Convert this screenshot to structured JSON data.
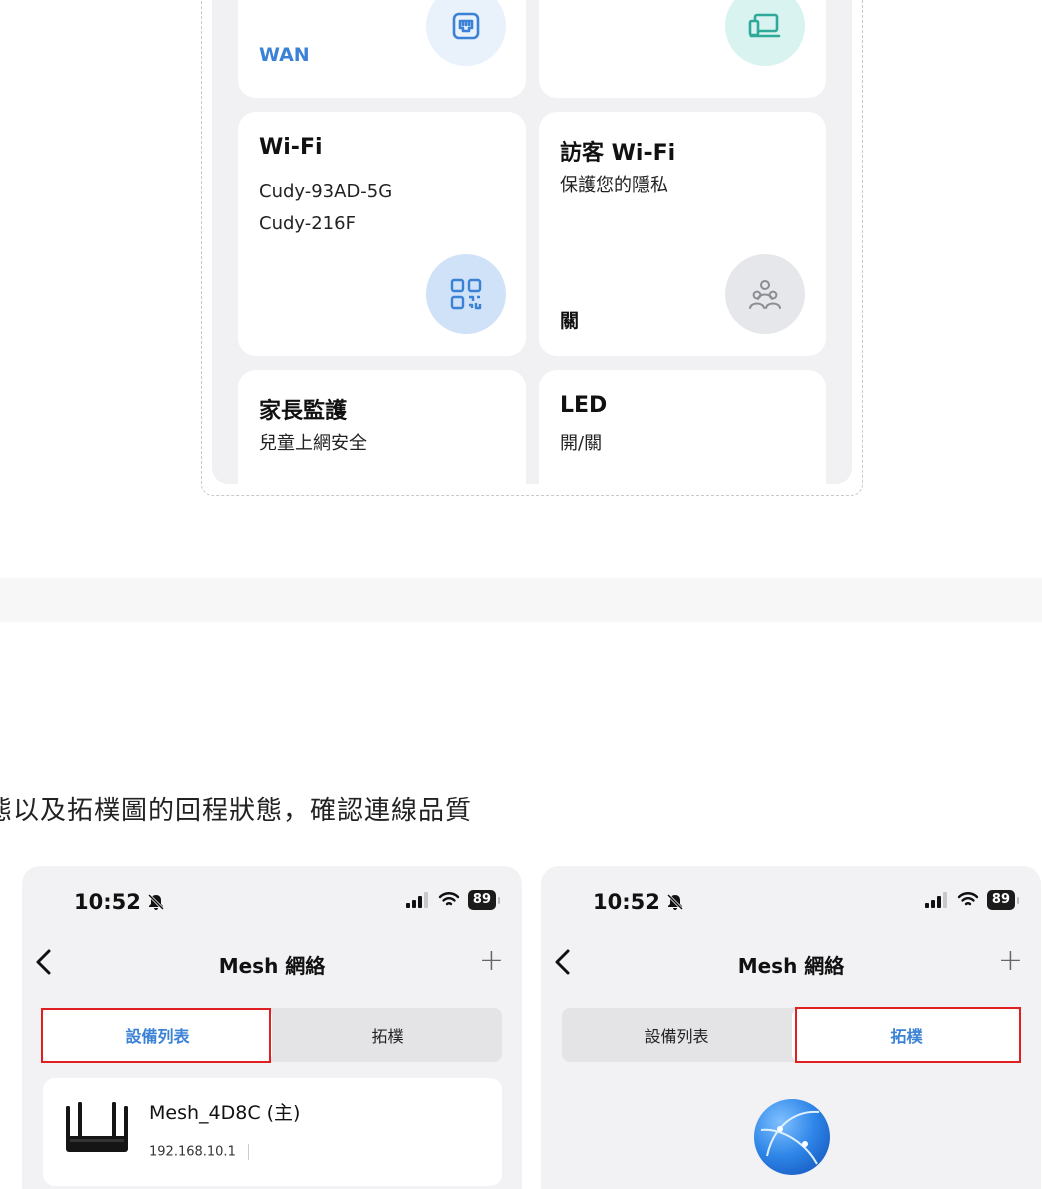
{
  "top_panel": {
    "tiles": {
      "wan": {
        "footer": "WAN",
        "icon": "ethernet-port-icon"
      },
      "devices": {
        "icon": "laptop-icon"
      },
      "wifi": {
        "title": "Wi-Fi",
        "ssids": [
          "Cudy-93AD-5G",
          "Cudy-216F"
        ],
        "icon": "qr-code-icon"
      },
      "guest_wifi": {
        "title": "訪客 Wi-Fi",
        "subtitle": "保護您的隱私",
        "status": "關",
        "icon": "users-icon"
      },
      "parental": {
        "title": "家長監護",
        "subtitle": "兒童上網安全"
      },
      "led": {
        "title": "LED",
        "subtitle": "開/關"
      }
    }
  },
  "caption": "態以及拓樸圖的回程狀態，確認連線品質",
  "phones": [
    {
      "time": "10:52",
      "battery": "89",
      "title": "Mesh 網絡",
      "plus": "+",
      "tabs": [
        "設備列表",
        "拓樸"
      ],
      "active_tab": 0,
      "device": {
        "name": "Mesh_4D8C (主)",
        "ip": "192.168.10.1"
      }
    },
    {
      "time": "10:52",
      "battery": "89",
      "title": "Mesh 網絡",
      "plus": "+",
      "tabs": [
        "設備列表",
        "拓樸"
      ],
      "active_tab": 1,
      "topology_icon": "globe-icon"
    }
  ],
  "colors": {
    "accent": "#3b82d6",
    "highlight": "#e02020",
    "panel_bg": "#f1f1f3"
  }
}
